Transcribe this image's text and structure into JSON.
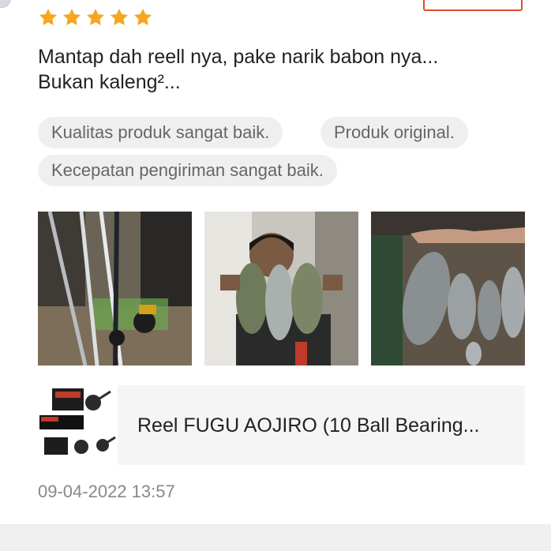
{
  "review": {
    "rating": 5,
    "max_rating": 5,
    "star_color": "#f6a623",
    "text_lines": [
      "Mantap dah reell nya, pake narik babon nya...",
      "Bukan kaleng²..."
    ],
    "tags": [
      "Kualitas produk sangat baik.",
      "Produk original.",
      "Kecepatan pengiriman sangat baik."
    ],
    "photos": [
      {
        "icon": "fishing-rods-photo"
      },
      {
        "icon": "person-holding-fish-photo"
      },
      {
        "icon": "fish-on-board-photo"
      }
    ],
    "product": {
      "name": "Reel FUGU AOJIRO (10 Ball Bearing..."
    },
    "timestamp": "09-04-2022 13:57"
  },
  "colors": {
    "accent": "#e04b2d",
    "tag_bg": "#efefef",
    "card_bg": "#f5f5f5"
  }
}
